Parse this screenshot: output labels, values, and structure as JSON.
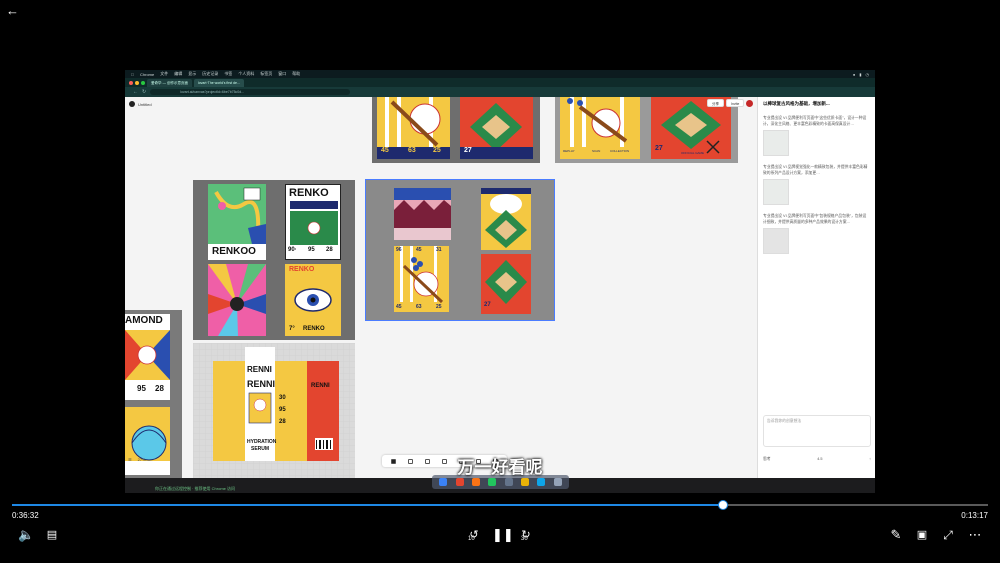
{
  "player": {
    "current_time": "0:36:32",
    "total_time": "0:13:17",
    "progress": 0.728,
    "subtitle": "万一好看呢",
    "skip_back_label": "10",
    "skip_forward_label": "30"
  },
  "mac_menubar": {
    "items": [
      "Chrome",
      "文件",
      "编辑",
      "显示",
      "历史记录",
      "书签",
      "个人资料",
      "标签页",
      "窗口",
      "帮助"
    ]
  },
  "browser": {
    "tabs": [
      "爱奇华 — 创作示意页面",
      "lovart·The world's first de..."
    ],
    "url": "lovart.ai/canvas?projectId=6be7b75c0d..."
  },
  "app": {
    "file_name": "Untitled",
    "zoom": "27%",
    "share_buttons": [
      "分享",
      "Invite"
    ]
  },
  "canvas_text": {
    "diamond": "AMOND",
    "diamond_nums": [
      "95",
      "28"
    ],
    "renkoo_label": "RENKOO",
    "renko_top": "RENKO",
    "renko_nums": [
      "90·",
      "95",
      "28"
    ],
    "renko_bottom": "RENKO",
    "renko_star": "7°",
    "renni_label": "RENNI",
    "renni_main": "RENNI",
    "renni_right": "RENNI",
    "hydration": "HYDRATION",
    "serum": "SERUM",
    "box_nums": [
      "30",
      "95",
      "28"
    ],
    "card_nums": [
      "45",
      "63",
      "25"
    ],
    "card_27": "27",
    "card_27b": "27",
    "card_27c": "27",
    "card_96": [
      "96",
      "45",
      "31"
    ],
    "card_sub": [
      "45",
      "63",
      "25"
    ],
    "small_bottom": [
      "REPLAY",
      "SCAN",
      "COLLECTION",
      "OFFICIAL GAME"
    ],
    "small_renko": "RENKO"
  },
  "side_panel": {
    "title": "以棒球复古风格为基础，增加新...",
    "messages": [
      "专业提出设 VI 品牌便利写页面中\"这些优质卡面\"，设计一种设计，深化主风格、更丰富色彩精致的卡面高保真设计…",
      "专业提出设 VI 品牌视觉强化一款精致包装，并提供丰富色彩精致的系列产品设计方案，添加更…",
      "专业提出设 VI 品牌便利写页面中\"包装规格产品包装\"，包装设计细致，并提供高质量的多种产品效果的设计方案…"
    ],
    "input_placeholder": "告诉我你的创意想法",
    "footer_left": "思考",
    "footer_mid": "4.5",
    "send_label": "↑"
  },
  "status_bar": "你正在通过远程控制 · 推荐使用 Chrome 访问",
  "colors": {
    "accent": "#1e88e5",
    "board": "#6e6e6e",
    "red": "#e3452f",
    "yellow": "#f4c842",
    "green": "#2a8a4a",
    "navy": "#1e2a6e"
  }
}
